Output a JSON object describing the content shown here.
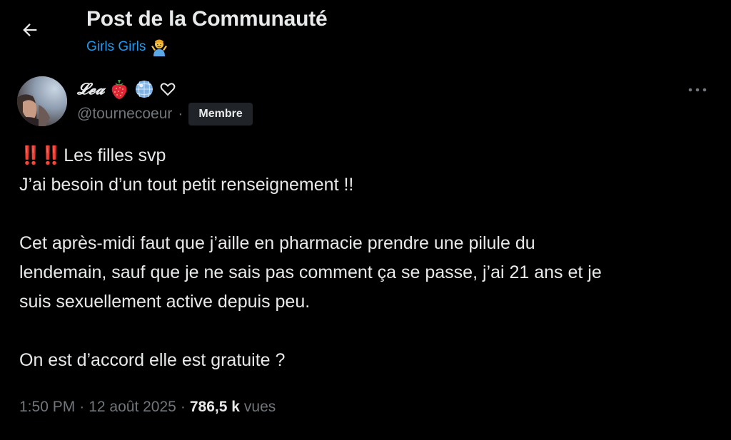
{
  "header": {
    "title": "Post de la Communauté",
    "community_name": "Girls Girls",
    "community_emoji": "person-shrugging-emoji"
  },
  "author": {
    "display_name": "𝓛𝓮𝓪",
    "name_emojis": [
      "strawberry-emoji",
      "mirror-ball-emoji",
      "white-heart-symbol"
    ],
    "handle": "@tournecoeur",
    "separator": "·",
    "role_badge": "Membre"
  },
  "post": {
    "line1_text": "Les filles svp",
    "line1_prefix": "‼️‼️",
    "line2": "J’ai besoin d’un tout petit renseignement !!",
    "para2_line1": "Cet après-midi faut que j’aille en pharmacie prendre une pilule du",
    "para2_line2": "lendemain, sauf que je ne sais pas comment ça se passe, j’ai 21 ans et je",
    "para2_line3": "suis sexuellement active depuis peu.",
    "para3": "On est d’accord elle est gratuite ?"
  },
  "meta": {
    "time": "1:50 PM",
    "sep1": "·",
    "date": "12 août 2025",
    "sep2": "·",
    "views_count": "786,5 k",
    "views_label": "vues"
  },
  "colors": {
    "background": "#000000",
    "text_primary": "#e7e9ea",
    "text_secondary": "#71767b",
    "accent_blue": "#1d9bf0",
    "badge_bg": "#202327",
    "double_exclamation_red": "#e0243a"
  }
}
